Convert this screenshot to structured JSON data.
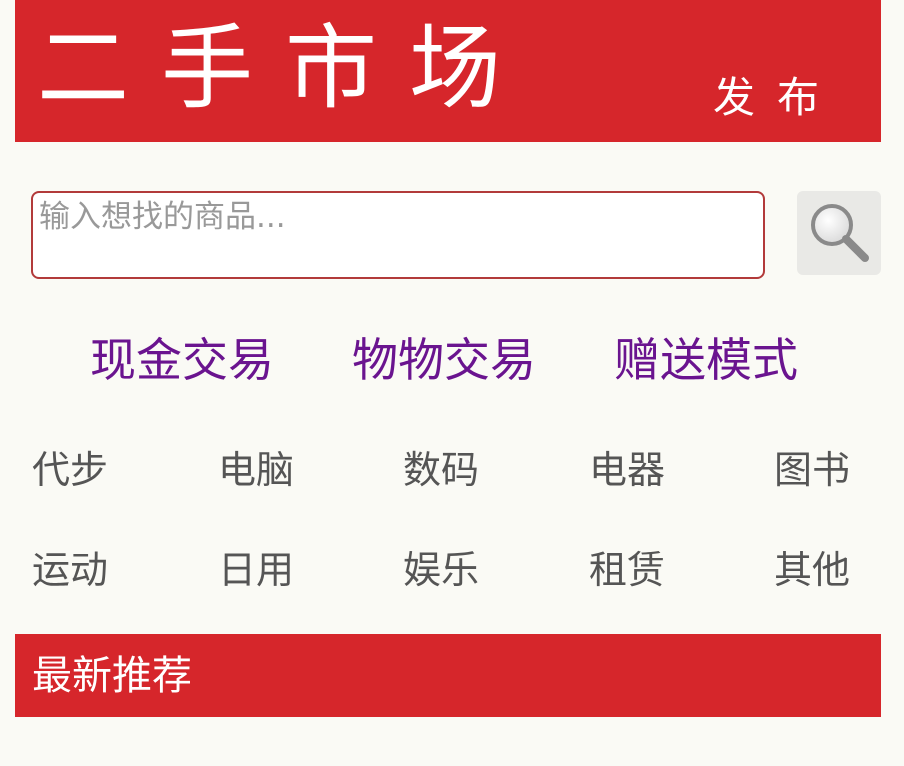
{
  "header": {
    "title": "二手市场",
    "publish_label": "发布"
  },
  "search": {
    "placeholder": "输入想找的商品...",
    "button_icon": "magnifier-icon"
  },
  "modes": [
    {
      "label": "现金交易"
    },
    {
      "label": "物物交易"
    },
    {
      "label": "赠送模式"
    }
  ],
  "categories": [
    {
      "label": "代步"
    },
    {
      "label": "电脑"
    },
    {
      "label": "数码"
    },
    {
      "label": "电器"
    },
    {
      "label": "图书"
    },
    {
      "label": "运动"
    },
    {
      "label": "日用"
    },
    {
      "label": "娱乐"
    },
    {
      "label": "租赁"
    },
    {
      "label": "其他"
    }
  ],
  "section": {
    "title": "最新推荐"
  },
  "colors": {
    "brand_red": "#d6262b",
    "mode_purple": "#6a148f",
    "background": "#fafaf5"
  }
}
